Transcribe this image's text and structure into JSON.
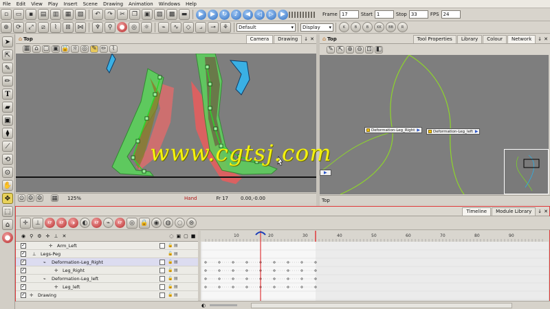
{
  "menu": [
    "File",
    "Edit",
    "View",
    "Play",
    "Insert",
    "Scene",
    "Drawing",
    "Animation",
    "Windows",
    "Help"
  ],
  "playback": {
    "frame_label": "Frame",
    "frame_value": "17",
    "start_label": "Start",
    "start_value": "1",
    "stop_label": "Stop",
    "stop_value": "33",
    "fps_label": "FPS",
    "fps_value": "24"
  },
  "toolbar2": {
    "palette_select": "Default",
    "display_select": "Display",
    "key_labels": [
      "K",
      "B",
      "B",
      "KK",
      "BB",
      "R"
    ]
  },
  "camera_panel": {
    "title": "Top",
    "tabs": [
      "Camera",
      "Drawing"
    ],
    "zoom": "125%",
    "tool": "Hand",
    "frame": "Fr 17",
    "coords": "0.00,-0.00"
  },
  "network_panel": {
    "title": "Top",
    "tabs": [
      "Tool Properties",
      "Library",
      "Colour",
      "Network"
    ],
    "nodes": [
      "Deformation-Leg_Right",
      "Deformation-Leg_left"
    ],
    "footer": "Top"
  },
  "timeline_panel": {
    "tabs": [
      "Timeline",
      "Module Library"
    ],
    "ruler_numbers": [
      "10",
      "20",
      "30",
      "40",
      "50",
      "60",
      "70",
      "80",
      "90"
    ],
    "current_frame": 17,
    "stop_frame": 33,
    "layers": [
      {
        "name": "Arm_Left",
        "indent": 60,
        "type": "drawing"
      },
      {
        "name": "Legs-Peg",
        "indent": 36,
        "type": "peg"
      },
      {
        "name": "Deformation-Leg_Right",
        "indent": 52,
        "type": "deform",
        "selected": true
      },
      {
        "name": "Leg_Right",
        "indent": 68,
        "type": "drawing"
      },
      {
        "name": "Deformation-Leg_left",
        "indent": 52,
        "type": "deform"
      },
      {
        "name": "Leg_left",
        "indent": 68,
        "type": "drawing"
      },
      {
        "name": "Drawing",
        "indent": 32,
        "type": "drawing"
      }
    ]
  },
  "watermark": "www.cgtsj.com",
  "colors": {
    "accent": "#e0383a",
    "selection": "#dcdcf0",
    "canvas": "#7e7e7e",
    "watermark": "#f4f20e"
  }
}
